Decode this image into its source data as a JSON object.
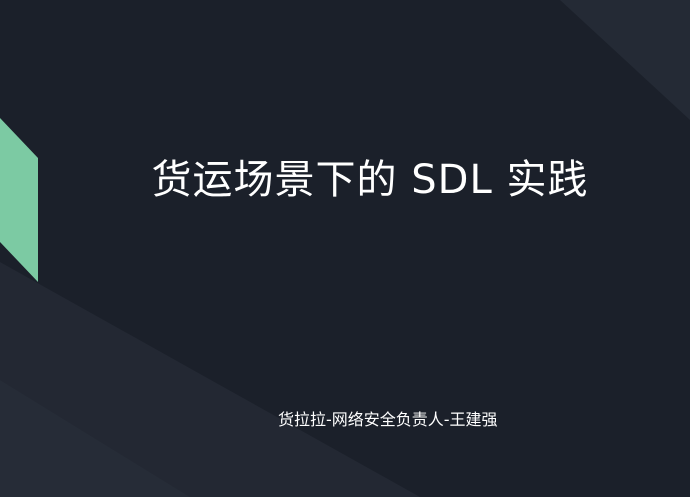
{
  "slide": {
    "title": "货运场景下的 SDL 实践",
    "subtitle": "货拉拉-网络安全负责人-王建强"
  },
  "colors": {
    "background": "#1b202a",
    "panel": "#242a35",
    "accent": "#7ccaa3",
    "text": "#ffffff"
  }
}
